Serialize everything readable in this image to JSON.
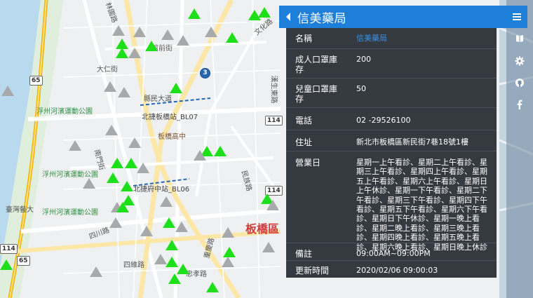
{
  "pharmacy": {
    "name": "信美藥局",
    "rows": [
      {
        "label": "名稱",
        "value": "信美藥局",
        "is_link": true
      },
      {
        "label": "成人口罩庫存",
        "value": "200"
      },
      {
        "label": "兒童口罩庫存",
        "value": "50"
      },
      {
        "label": "電話",
        "value": "02 -29526100"
      },
      {
        "label": "住址",
        "value": "新北市板橋區新民街7巷18號1樓"
      },
      {
        "label": "營業日",
        "value": "星期一上午看診、星期二上午看診、星期三上午看診、星期四上午看診、星期五上午看診、星期六上午看診、星期日上午休診、星期一下午看診、星期二下午看診、星期三下午看診、星期四下午看診、星期五下午看診、星期六下午看診、星期日下午休診、星期一晚上看診、星期二晚上看診、星期三晚上看診、星期四晚上看診、星期五晚上看診、星期六晚上看診、星期日晚上休診"
      },
      {
        "label": "備註",
        "value": "09:00AM~09:00PM"
      },
      {
        "label": "更新時間",
        "value": "2020/02/06 09:00:03"
      }
    ]
  },
  "toolbar": {
    "icons": [
      "book-icon",
      "gear-icon",
      "github-icon",
      "facebook-icon"
    ]
  },
  "map_labels": {
    "park_1": "浮州河濱運動公園",
    "park_2": "浮州河濱運動公園",
    "park_3": "浮州河濱運動公園",
    "bridge": "臺灣藝大",
    "station_1": "北捷板橋站_BL07",
    "station_2": "北捷府中站_BL06",
    "school": "板橋高中",
    "district": "板橋區",
    "road_1": "民族路",
    "road_2": "大仁街",
    "road_3": "館前街",
    "road_4": "縣民大道",
    "road_5": "文化路",
    "road_6": "重慶路",
    "road_7": "忠孝路",
    "road_8": "四川路",
    "road_9": "南門街",
    "road_10": "四維路",
    "road_11": "漢生東路",
    "road_12": "林園路",
    "shield_65a": "65",
    "shield_65b": "65",
    "shield_114a": "114",
    "shield_114b": "114",
    "shield_114c": "114",
    "shield_3": "3"
  },
  "colors": {
    "header": "#1e7fd8",
    "panel": "#343a40",
    "marker_available": "#1ee01a",
    "marker_unavailable": "#a7a9ab",
    "link": "#3d8fe0"
  }
}
